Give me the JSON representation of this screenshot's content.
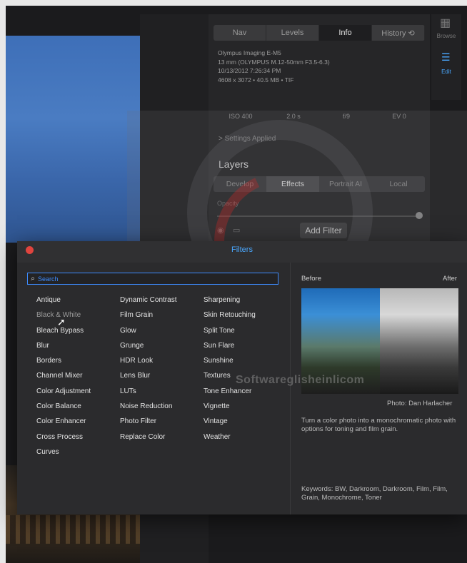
{
  "nav_tabs": [
    {
      "label": "Nav",
      "active": false
    },
    {
      "label": "Levels",
      "active": false
    },
    {
      "label": "Info",
      "active": true
    },
    {
      "label": "History ⟲",
      "active": false
    }
  ],
  "info": {
    "camera": "Olympus Imaging E-M5",
    "lens": "13 mm (OLYMPUS M.12-50mm F3.5-6.3)",
    "date": "10/13/2012 7:26:34 PM",
    "file": "4608 x 3072 • 40.5 MB • TIF"
  },
  "exposure": [
    "ISO 400",
    "2.0 s",
    "f/9",
    "EV 0"
  ],
  "settings_applied": "> Settings Applied",
  "layers": {
    "title": "Layers",
    "tabs": [
      {
        "label": "Develop",
        "active": false
      },
      {
        "label": "Effects",
        "active": true
      },
      {
        "label": "Portrait AI",
        "active": false
      },
      {
        "label": "Local",
        "active": false
      }
    ],
    "opacity_label": "Opacity",
    "add_filter": "Add Filter"
  },
  "toolbar": {
    "browse": "Browse",
    "edit": "Edit"
  },
  "dialog": {
    "title": "Filters",
    "search_placeholder": "Search",
    "columns": [
      [
        "Antique",
        "Black & White",
        "Bleach Bypass",
        "Blur",
        "Borders",
        "Channel Mixer",
        "Color Adjustment",
        "Color Balance",
        "Color Enhancer",
        "Cross Process",
        "Curves"
      ],
      [
        "Dynamic Contrast",
        "Film Grain",
        "Glow",
        "Grunge",
        "HDR Look",
        "Lens Blur",
        "LUTs",
        "Noise Reduction",
        "Photo Filter",
        "Replace Color"
      ],
      [
        "Sharpening",
        "Skin Retouching",
        "Split Tone",
        "Sun Flare",
        "Sunshine",
        "Textures",
        "Tone Enhancer",
        "Vignette",
        "Vintage",
        "Weather"
      ]
    ],
    "before": "Before",
    "after": "After",
    "credit": "Photo: Dan Harlacher",
    "description": "Turn a color photo into a monochromatic photo with options for toning and film grain.",
    "keywords": "Keywords: BW, Darkroom, Darkroom, Film, Film, Grain, Monochrome, Toner"
  },
  "watermark": "Softwareglisheinlicom"
}
